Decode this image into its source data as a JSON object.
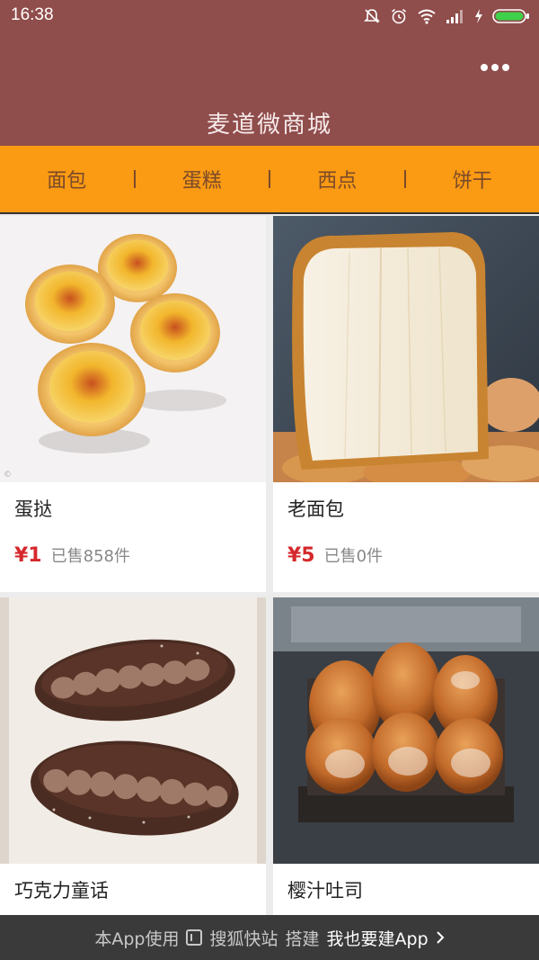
{
  "status": {
    "time": "16:38",
    "icons": [
      "mute-icon",
      "alarm-icon",
      "wifi-icon",
      "signal-icon",
      "charging-icon",
      "battery-icon"
    ]
  },
  "header": {
    "title": "麦道微商城",
    "menu_icon": "more-dots-icon"
  },
  "nav": {
    "tabs": [
      "面包",
      "蛋糕",
      "西点",
      "饼干"
    ]
  },
  "products": [
    {
      "name": "蛋挞",
      "price": "¥1",
      "sold": "已售858件",
      "image": "egg-tart"
    },
    {
      "name": "老面包",
      "price": "¥5",
      "sold": "已售0件",
      "image": "old-bread"
    },
    {
      "name": "巧克力童话",
      "price": "",
      "sold": "",
      "image": "chocolate-bread"
    },
    {
      "name": "樱汁吐司",
      "price": "",
      "sold": "",
      "image": "toast-loaf"
    }
  ],
  "footer": {
    "prefix": "本App使用",
    "brand": "搜狐快站",
    "middle": "搭建",
    "cta": "我也要建App",
    "cta_icon": "chevron-right-icon"
  },
  "colors": {
    "header_bg": "#8f4d4b",
    "nav_bg": "#fb9a13",
    "price": "#d6282c",
    "footer_bg": "#3a3a3a"
  }
}
